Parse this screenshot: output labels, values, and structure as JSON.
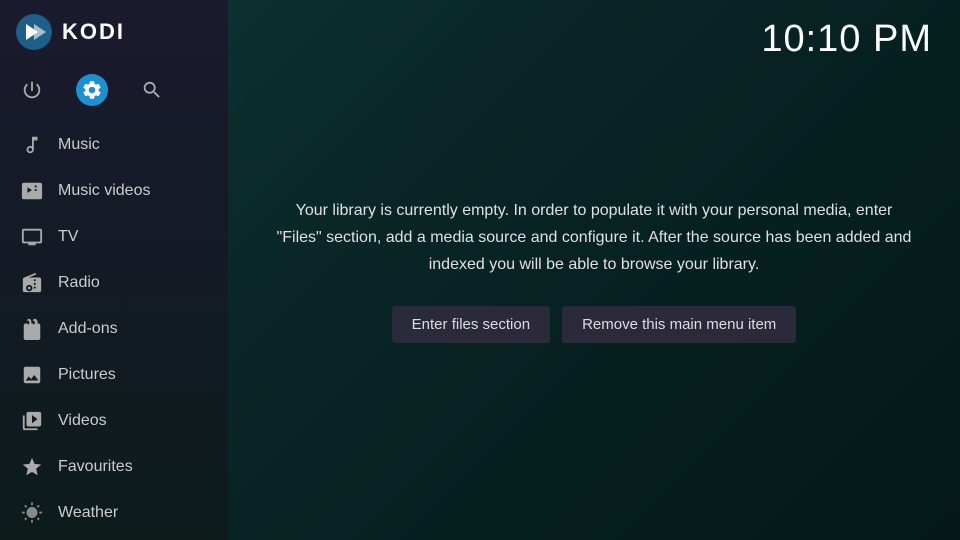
{
  "app": {
    "name": "KODI",
    "clock": "10:10 PM"
  },
  "sidebar": {
    "header_icon": "kodi-logo",
    "toolbar": {
      "power_label": "power",
      "settings_label": "settings",
      "search_label": "search"
    },
    "nav_items": [
      {
        "id": "music",
        "label": "Music",
        "icon": "music"
      },
      {
        "id": "music-videos",
        "label": "Music videos",
        "icon": "music-video"
      },
      {
        "id": "tv",
        "label": "TV",
        "icon": "tv"
      },
      {
        "id": "radio",
        "label": "Radio",
        "icon": "radio"
      },
      {
        "id": "add-ons",
        "label": "Add-ons",
        "icon": "addon"
      },
      {
        "id": "pictures",
        "label": "Pictures",
        "icon": "picture"
      },
      {
        "id": "videos",
        "label": "Videos",
        "icon": "video"
      },
      {
        "id": "favourites",
        "label": "Favourites",
        "icon": "star"
      },
      {
        "id": "weather",
        "label": "Weather",
        "icon": "weather"
      }
    ]
  },
  "main": {
    "dialog": {
      "text": "Your library is currently empty. In order to populate it with your personal media, enter \"Files\" section, add a media source and configure it. After the source has been added and indexed you will be able to browse your library.",
      "btn_enter": "Enter files section",
      "btn_remove": "Remove this main menu item"
    }
  }
}
